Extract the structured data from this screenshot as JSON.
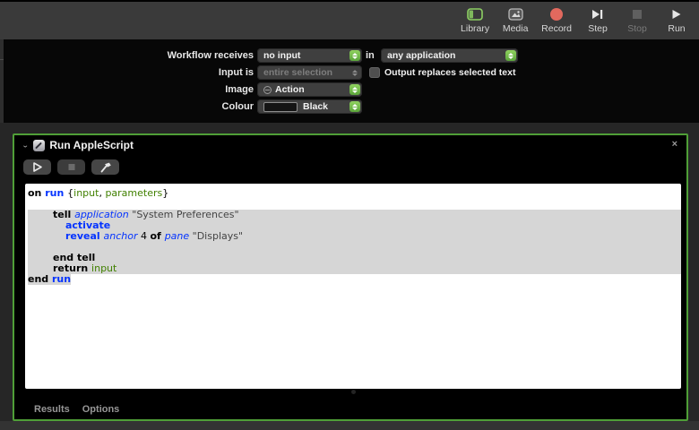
{
  "toolbar": {
    "items": [
      {
        "label": "Library",
        "icon": "library-icon",
        "enabled": true
      },
      {
        "label": "Media",
        "icon": "media-icon",
        "enabled": true
      },
      {
        "label": "Record",
        "icon": "record-icon",
        "enabled": true
      },
      {
        "label": "Step",
        "icon": "step-icon",
        "enabled": true
      },
      {
        "label": "Stop",
        "icon": "stop-icon",
        "enabled": false
      },
      {
        "label": "Run",
        "icon": "run-icon",
        "enabled": true
      }
    ]
  },
  "options_panel": {
    "workflow_receives": {
      "label": "Workflow receives",
      "value": "no input",
      "in_label": "in",
      "app_value": "any application"
    },
    "input_is": {
      "label": "Input is",
      "value": "entire selection",
      "disabled": true,
      "checkbox_label": "Output replaces selected text",
      "checkbox_checked": false
    },
    "image": {
      "label": "Image",
      "value": "Action"
    },
    "colour": {
      "label": "Colour",
      "value": "Black"
    }
  },
  "action": {
    "title": "Run AppleScript",
    "close_label": "×",
    "disclosure": "⌄",
    "buttons": [
      "run-script",
      "stop-script",
      "compile-script"
    ],
    "footer_tabs": [
      {
        "label": "Results"
      },
      {
        "label": "Options"
      }
    ],
    "code": {
      "lines": [
        {
          "hl": "none",
          "tokens": [
            [
              "kw",
              "on "
            ],
            [
              "cmd",
              "run "
            ],
            [
              "plain",
              "{"
            ],
            [
              "var",
              "input"
            ],
            [
              "plain",
              ", "
            ],
            [
              "var",
              "parameters"
            ],
            [
              "plain",
              "}"
            ]
          ]
        },
        {
          "hl": "none",
          "tokens": []
        },
        {
          "hl": "full",
          "tokens": [
            [
              "plain",
              "        "
            ],
            [
              "kw",
              "tell "
            ],
            [
              "app",
              "application "
            ],
            [
              "str",
              "\"System Preferences\""
            ]
          ]
        },
        {
          "hl": "full",
          "tokens": [
            [
              "plain",
              "            "
            ],
            [
              "cmd",
              "activate"
            ]
          ]
        },
        {
          "hl": "full",
          "tokens": [
            [
              "plain",
              "            "
            ],
            [
              "cmd",
              "reveal "
            ],
            [
              "app",
              "anchor "
            ],
            [
              "num",
              "4 "
            ],
            [
              "kw",
              "of "
            ],
            [
              "app",
              "pane "
            ],
            [
              "str",
              "\"Displays\""
            ]
          ]
        },
        {
          "hl": "full",
          "tokens": []
        },
        {
          "hl": "full",
          "tokens": [
            [
              "plain",
              "        "
            ],
            [
              "kw",
              "end tell"
            ]
          ]
        },
        {
          "hl": "full",
          "tokens": [
            [
              "plain",
              "        "
            ],
            [
              "kw",
              "return "
            ],
            [
              "var",
              "input"
            ]
          ]
        },
        {
          "hl": "text",
          "tokens": [
            [
              "kw",
              "end "
            ],
            [
              "cmd",
              "run"
            ]
          ]
        }
      ]
    }
  },
  "colors": {
    "accent_green": "#4f9e37",
    "stepper_green": "#6cb843",
    "record_red": "#e2695e",
    "selection_grey": "#d6d6d6",
    "keyword_blue": "#0433ff",
    "variable_green": "#418000"
  }
}
